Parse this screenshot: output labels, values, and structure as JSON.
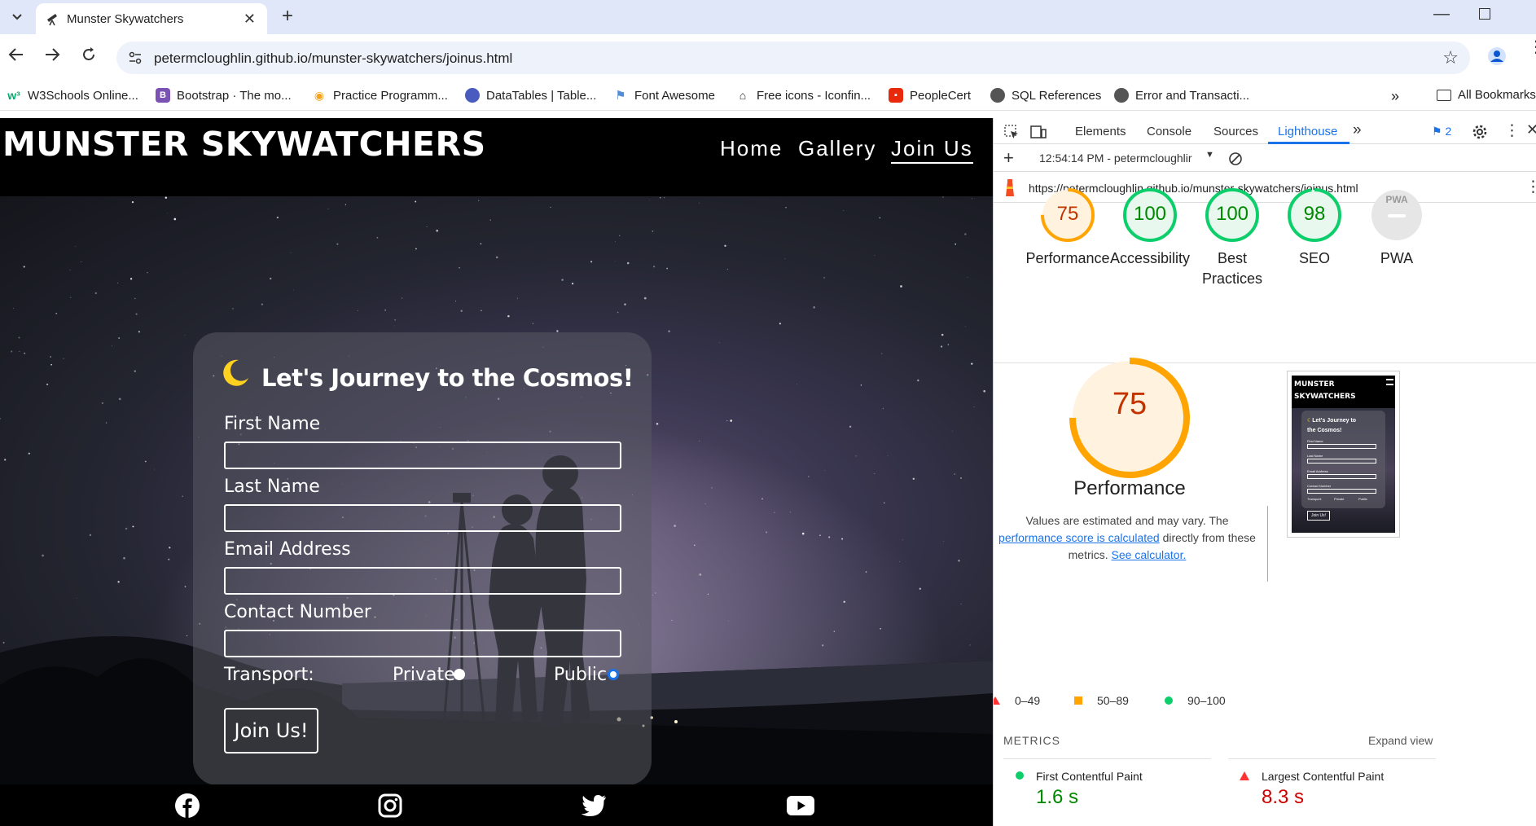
{
  "browser": {
    "tab_title": "Munster Skywatchers",
    "url": "petermcloughlin.github.io/munster-skywatchers/joinus.html",
    "bookmarks": [
      {
        "label": "W3Schools Online...",
        "icon": "w3schools-icon",
        "color": "#04aa6d"
      },
      {
        "label": "Bootstrap · The mo...",
        "icon": "bootstrap-icon",
        "color": "#7952b3"
      },
      {
        "label": "Practice Programm...",
        "icon": "practice-icon",
        "color": "#f7a21b"
      },
      {
        "label": "DataTables | Table...",
        "icon": "datatables-icon",
        "color": "#4a5bbf"
      },
      {
        "label": "Font Awesome",
        "icon": "flag-icon",
        "color": "#528dd7"
      },
      {
        "label": "Free icons - Iconfin...",
        "icon": "iconfinder-icon",
        "color": "#1f1f1f"
      },
      {
        "label": "PeopleCert",
        "icon": "peoplecert-icon",
        "color": "#e8290b"
      },
      {
        "label": "SQL References",
        "icon": "globe-icon",
        "color": "#555555"
      },
      {
        "label": "Error and Transacti...",
        "icon": "globe-icon",
        "color": "#555555"
      }
    ],
    "all_bookmarks": "All Bookmarks"
  },
  "site": {
    "logo": "MUNSTER SKYWATCHERS",
    "nav": [
      "Home",
      "Gallery",
      "Join Us"
    ],
    "form": {
      "heading": "Let's Journey to the Cosmos!",
      "fields": [
        "First Name",
        "Last Name",
        "Email Address",
        "Contact Number"
      ],
      "transport_label": "Transport:",
      "options": [
        "Private",
        "Public"
      ],
      "selected_option": "Public",
      "submit": "Join Us!"
    },
    "footer_icons": [
      "facebook-icon",
      "instagram-icon",
      "twitter-icon",
      "youtube-icon"
    ]
  },
  "devtools": {
    "tabs": [
      "Elements",
      "Console",
      "Sources",
      "Lighthouse"
    ],
    "active_tab": "Lighthouse",
    "issues_count": "2",
    "report_time": "12:54:14 PM - petermcloughlir",
    "report_url": "https://petermcloughlin.github.io/munster-skywatchers/joinus.html",
    "scores": [
      {
        "label": "Performance",
        "value": "75",
        "score": 75,
        "color": "#ffa400",
        "track": "#fff3e0",
        "text_color": "#c33300"
      },
      {
        "label": "Accessibility",
        "value": "100",
        "score": 100,
        "color": "#0cce6b",
        "track": "#e8f8ef",
        "text_color": "#008800"
      },
      {
        "label": "Best Practices",
        "value": "100",
        "score": 100,
        "color": "#0cce6b",
        "track": "#e8f8ef",
        "text_color": "#008800"
      },
      {
        "label": "SEO",
        "value": "98",
        "score": 98,
        "color": "#0cce6b",
        "track": "#e8f8ef",
        "text_color": "#008800"
      },
      {
        "label": "PWA",
        "value": "PWA",
        "score": 0,
        "color": "#cccccc",
        "track": "#e6e6e6",
        "text_color": "#999999"
      }
    ],
    "big_score": "75",
    "big_label": "Performance",
    "note_line1": "Values are estimated and may vary. The",
    "note_link1": "performance score is calculated",
    "note_line2": "directly from these",
    "note_line3": "metrics.",
    "note_link2": "See calculator.",
    "legend": [
      {
        "range": "0–49",
        "color": "#ff3333"
      },
      {
        "range": "50–89",
        "color": "#ffa400"
      },
      {
        "range": "90–100",
        "color": "#0cce6b"
      }
    ],
    "metrics_title": "METRICS",
    "expand_view": "Expand view",
    "metrics": [
      {
        "name": "First Contentful Paint",
        "value": "1.6 s",
        "color": "#008800",
        "status": "good"
      },
      {
        "name": "Largest Contentful Paint",
        "value": "8.3 s",
        "color": "#cc0000",
        "status": "fail"
      }
    ],
    "thumb": {
      "logo_line1": "MUNSTER",
      "logo_line2": "SKYWATCHERS",
      "heading_line1": "Let's Journey to",
      "heading_line2": "the Cosmos!",
      "fields": [
        "First Name",
        "Last Name",
        "Email Address",
        "Contact Number"
      ],
      "transport": "Transport:",
      "opt1": "Private",
      "opt2": "Public",
      "button": "Join Us!"
    }
  }
}
